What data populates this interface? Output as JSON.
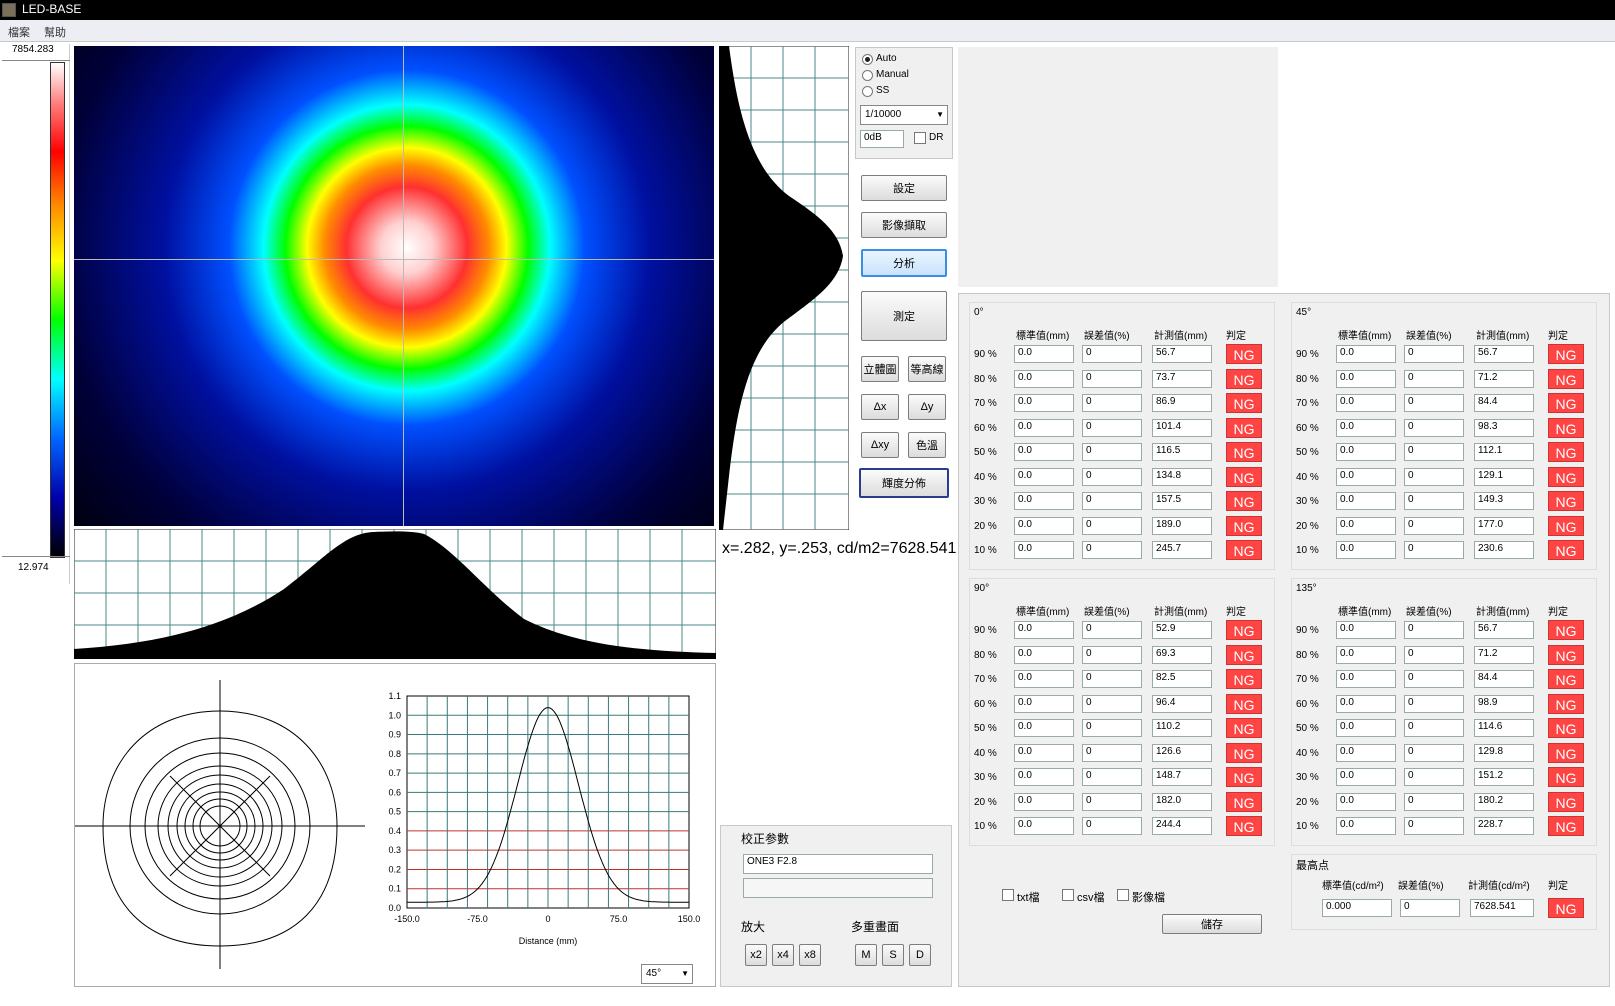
{
  "app": {
    "title": "LED-BASE"
  },
  "menu": [
    "檔案",
    "幫助"
  ],
  "colorbar": {
    "max": "7854.283",
    "min": "12.974"
  },
  "exposure": {
    "modes": [
      "Auto",
      "Manual",
      "SS"
    ],
    "selected": "Auto",
    "shutter": "1/10000",
    "gain": "0dB",
    "dr_label": "DR"
  },
  "buttons": {
    "settings": "設定",
    "capture": "影像擷取",
    "analyze": "分析",
    "measure": "測定",
    "solid": "立體圖",
    "contour": "等高線",
    "dx": "Δx",
    "dy": "Δy",
    "dxy": "Δxy",
    "color_temp": "色溫",
    "luminance": "輝度分佈"
  },
  "readout": "x=.282, y=.253, cd/m2=7628.541",
  "calib": {
    "title": "校正参數",
    "value": "ONE3 F2.8",
    "value2": ""
  },
  "zoom": {
    "title": "放大",
    "buttons": [
      "x2",
      "x4",
      "x8"
    ]
  },
  "multi": {
    "title": "多重畫面",
    "buttons": [
      "M",
      "S",
      "D"
    ]
  },
  "plot": {
    "angle": "45°",
    "xlabel": "Distance (mm)",
    "xticks": [
      "-150.0",
      "-75.0",
      "0",
      "75.0",
      "150.0"
    ],
    "yticks": [
      "0.0",
      "0.1",
      "0.2",
      "0.3",
      "0.4",
      "0.5",
      "0.6",
      "0.7",
      "0.8",
      "0.9",
      "1.0",
      "1.1"
    ]
  },
  "table_headers": {
    "std": "標準值(mm)",
    "err": "誤差值(%)",
    "meas": "計測值(mm)",
    "judge": "判定"
  },
  "groups": [
    {
      "title": "0°",
      "rows": [
        {
          "pct": "90 %",
          "std": "0.0",
          "err": "0",
          "meas": "56.7",
          "judge": "NG"
        },
        {
          "pct": "80 %",
          "std": "0.0",
          "err": "0",
          "meas": "73.7",
          "judge": "NG"
        },
        {
          "pct": "70 %",
          "std": "0.0",
          "err": "0",
          "meas": "86.9",
          "judge": "NG"
        },
        {
          "pct": "60 %",
          "std": "0.0",
          "err": "0",
          "meas": "101.4",
          "judge": "NG"
        },
        {
          "pct": "50 %",
          "std": "0.0",
          "err": "0",
          "meas": "116.5",
          "judge": "NG"
        },
        {
          "pct": "40 %",
          "std": "0.0",
          "err": "0",
          "meas": "134.8",
          "judge": "NG"
        },
        {
          "pct": "30 %",
          "std": "0.0",
          "err": "0",
          "meas": "157.5",
          "judge": "NG"
        },
        {
          "pct": "20 %",
          "std": "0.0",
          "err": "0",
          "meas": "189.0",
          "judge": "NG"
        },
        {
          "pct": "10 %",
          "std": "0.0",
          "err": "0",
          "meas": "245.7",
          "judge": "NG"
        }
      ]
    },
    {
      "title": "45°",
      "rows": [
        {
          "pct": "90 %",
          "std": "0.0",
          "err": "0",
          "meas": "56.7",
          "judge": "NG"
        },
        {
          "pct": "80 %",
          "std": "0.0",
          "err": "0",
          "meas": "71.2",
          "judge": "NG"
        },
        {
          "pct": "70 %",
          "std": "0.0",
          "err": "0",
          "meas": "84.4",
          "judge": "NG"
        },
        {
          "pct": "60 %",
          "std": "0.0",
          "err": "0",
          "meas": "98.3",
          "judge": "NG"
        },
        {
          "pct": "50 %",
          "std": "0.0",
          "err": "0",
          "meas": "112.1",
          "judge": "NG"
        },
        {
          "pct": "40 %",
          "std": "0.0",
          "err": "0",
          "meas": "129.1",
          "judge": "NG"
        },
        {
          "pct": "30 %",
          "std": "0.0",
          "err": "0",
          "meas": "149.3",
          "judge": "NG"
        },
        {
          "pct": "20 %",
          "std": "0.0",
          "err": "0",
          "meas": "177.0",
          "judge": "NG"
        },
        {
          "pct": "10 %",
          "std": "0.0",
          "err": "0",
          "meas": "230.6",
          "judge": "NG"
        }
      ]
    },
    {
      "title": "90°",
      "rows": [
        {
          "pct": "90 %",
          "std": "0.0",
          "err": "0",
          "meas": "52.9",
          "judge": "NG"
        },
        {
          "pct": "80 %",
          "std": "0.0",
          "err": "0",
          "meas": "69.3",
          "judge": "NG"
        },
        {
          "pct": "70 %",
          "std": "0.0",
          "err": "0",
          "meas": "82.5",
          "judge": "NG"
        },
        {
          "pct": "60 %",
          "std": "0.0",
          "err": "0",
          "meas": "96.4",
          "judge": "NG"
        },
        {
          "pct": "50 %",
          "std": "0.0",
          "err": "0",
          "meas": "110.2",
          "judge": "NG"
        },
        {
          "pct": "40 %",
          "std": "0.0",
          "err": "0",
          "meas": "126.6",
          "judge": "NG"
        },
        {
          "pct": "30 %",
          "std": "0.0",
          "err": "0",
          "meas": "148.7",
          "judge": "NG"
        },
        {
          "pct": "20 %",
          "std": "0.0",
          "err": "0",
          "meas": "182.0",
          "judge": "NG"
        },
        {
          "pct": "10 %",
          "std": "0.0",
          "err": "0",
          "meas": "244.4",
          "judge": "NG"
        }
      ]
    },
    {
      "title": "135°",
      "rows": [
        {
          "pct": "90 %",
          "std": "0.0",
          "err": "0",
          "meas": "56.7",
          "judge": "NG"
        },
        {
          "pct": "80 %",
          "std": "0.0",
          "err": "0",
          "meas": "71.2",
          "judge": "NG"
        },
        {
          "pct": "70 %",
          "std": "0.0",
          "err": "0",
          "meas": "84.4",
          "judge": "NG"
        },
        {
          "pct": "60 %",
          "std": "0.0",
          "err": "0",
          "meas": "98.9",
          "judge": "NG"
        },
        {
          "pct": "50 %",
          "std": "0.0",
          "err": "0",
          "meas": "114.6",
          "judge": "NG"
        },
        {
          "pct": "40 %",
          "std": "0.0",
          "err": "0",
          "meas": "129.8",
          "judge": "NG"
        },
        {
          "pct": "30 %",
          "std": "0.0",
          "err": "0",
          "meas": "151.2",
          "judge": "NG"
        },
        {
          "pct": "20 %",
          "std": "0.0",
          "err": "0",
          "meas": "180.2",
          "judge": "NG"
        },
        {
          "pct": "10 %",
          "std": "0.0",
          "err": "0",
          "meas": "228.7",
          "judge": "NG"
        }
      ]
    }
  ],
  "peak": {
    "title": "最高点",
    "std_label": "標準值(cd/m²)",
    "err_label": "誤差值(%)",
    "meas_label": "計測值(cd/m²)",
    "judge_label": "判定",
    "std": "0.000",
    "err": "0",
    "meas": "7628.541",
    "judge": "NG"
  },
  "export": {
    "txt": "txt檔",
    "csv": "csv檔",
    "img": "影像檔",
    "save": "儲存"
  }
}
